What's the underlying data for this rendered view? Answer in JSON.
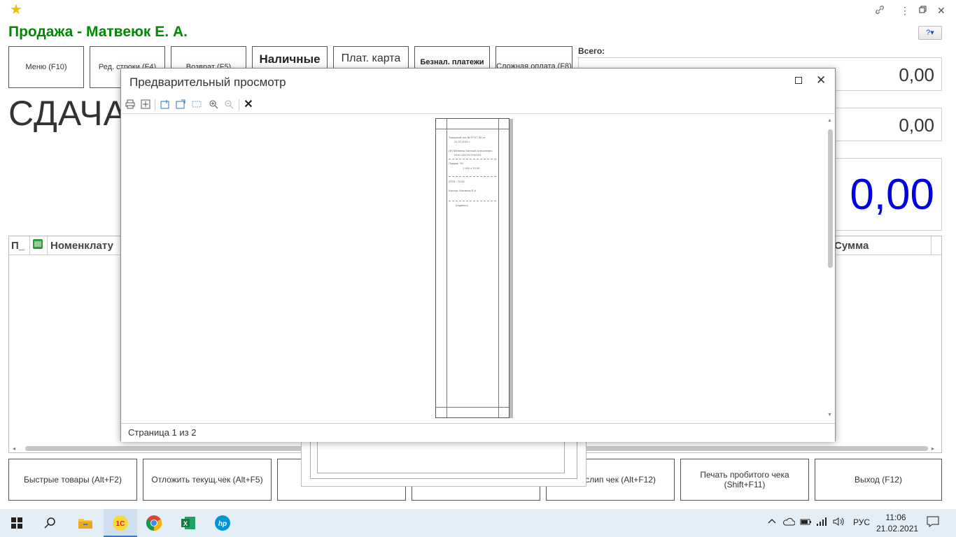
{
  "app": {
    "title": "Продажа - Матвеюк Е. А.",
    "help_label": "?▾"
  },
  "toolbar": {
    "menu": "Меню (F10)",
    "edit_row": "Ред. строки (F4)",
    "return": "Возврат (F5)",
    "cash": "Наличные",
    "card": "Плат. карта",
    "cashless": "Безнал. платежи",
    "complex_pay": "Сложная оплата (F8)"
  },
  "totals": {
    "label": "Всего:",
    "total": "0,00",
    "paid": "0,00",
    "change": "0,00",
    "change_color": "#0000e6"
  },
  "change_label": "СДАЧА",
  "grid": {
    "columns": [
      "П_",
      "Номенклату",
      "Сумма"
    ]
  },
  "bottom_buttons": {
    "quick_goods": "Быстрые товары (Alt+F2)",
    "defer_check": "Отложить текущ.чек (Alt+F5)",
    "btn3": "",
    "btn4": "",
    "slip": "д. слип чек (Alt+F12)",
    "print_check": "Печать пробитого чека (Shift+F11)",
    "exit": "Выход (F12)"
  },
  "preview": {
    "title": "Предварительный просмотр",
    "status": "Страница 1 из 2",
    "receipt_lines": [
      "Товарный чек № РГ0Т-95 от",
      "21.02.2021 г.",
      "ИП Матвеюк Евгений Алексеевич",
      "ИНН 4357317Р00ЭЭ",
      "Пиджак \"КС",
      "1 000 х 70.00",
      "ИТОГ:                 70.00",
      "Кассир:          Матвеюк Е.А.",
      "(подпись)"
    ]
  },
  "taskbar": {
    "lang": "РУС",
    "time": "11:06",
    "date": "21.02.2021"
  }
}
